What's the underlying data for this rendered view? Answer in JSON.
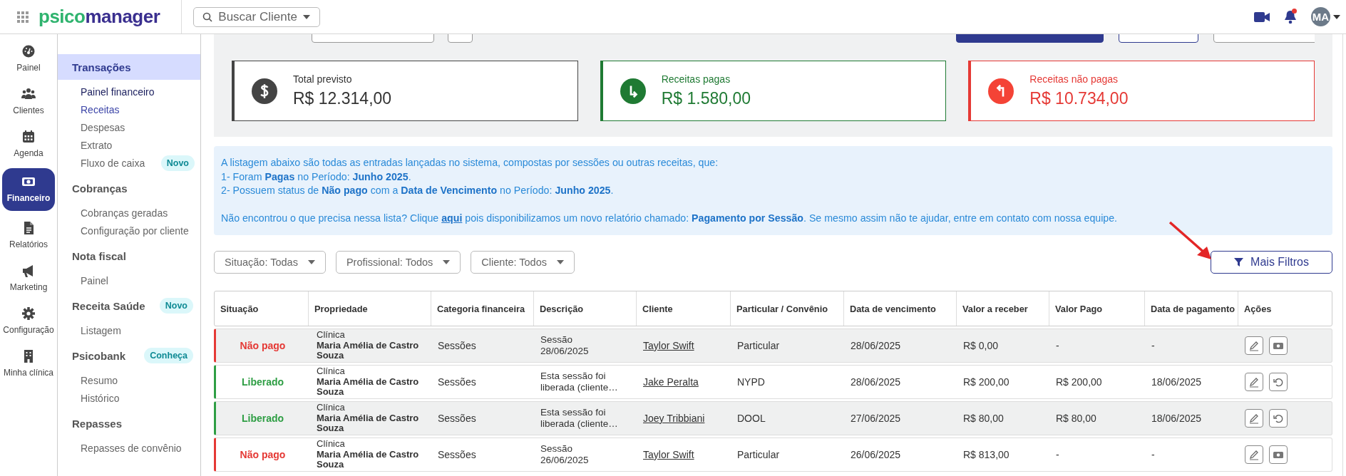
{
  "topbar": {
    "logo": {
      "part_1": "psico",
      "part_2": "manager"
    },
    "search": {
      "label": "Buscar Cliente"
    },
    "notifications": {
      "unread": true
    },
    "avatar": {
      "initials": "MA"
    }
  },
  "rail": [
    {
      "label": "Painel",
      "kind": "dashboard",
      "selected": false
    },
    {
      "label": "Clientes",
      "kind": "people",
      "selected": false
    },
    {
      "label": "Agenda",
      "kind": "calendar",
      "selected": false
    },
    {
      "label": "Financeiro",
      "kind": "money",
      "selected": true
    },
    {
      "label": "Relatórios",
      "kind": "document",
      "selected": false
    },
    {
      "label": "Marketing",
      "kind": "megaphone",
      "selected": false
    },
    {
      "label": "Configuração",
      "kind": "gear",
      "selected": false
    },
    {
      "label": "Minha clínica",
      "kind": "building",
      "selected": false
    }
  ],
  "menu": [
    {
      "title": "Transações",
      "selected": true,
      "items": [
        {
          "label": "Painel financeiro",
          "selected": true,
          "hovered": false
        },
        {
          "label": "Receitas",
          "selected": false,
          "hovered": true
        },
        {
          "label": "Despesas",
          "selected": false,
          "hovered": false
        },
        {
          "label": "Extrato",
          "selected": false,
          "hovered": false
        },
        {
          "label": "Fluxo de caixa",
          "badge": "Novo",
          "selected": false,
          "hovered": false
        }
      ]
    },
    {
      "title": "Cobranças",
      "selected": false,
      "items": [
        {
          "label": "Cobranças geradas",
          "selected": false,
          "hovered": false
        },
        {
          "label": "Configuração por cliente",
          "selected": false,
          "hovered": false
        }
      ]
    },
    {
      "title": "Nota fiscal",
      "selected": false,
      "items": [
        {
          "label": "Painel",
          "selected": false,
          "hovered": false
        }
      ]
    },
    {
      "title": "Receita Saúde",
      "badge": "Novo",
      "selected": false,
      "items": [
        {
          "label": "Listagem",
          "selected": false,
          "hovered": false
        }
      ]
    },
    {
      "title": "Psicobank",
      "badge": "Conheça",
      "selected": false,
      "items": [
        {
          "label": "Resumo",
          "selected": false,
          "hovered": false
        },
        {
          "label": "Histórico",
          "selected": false,
          "hovered": false
        }
      ]
    },
    {
      "title": "Repasses",
      "selected": false,
      "items": [
        {
          "label": "Repasses de convênio",
          "selected": false,
          "hovered": false
        }
      ]
    }
  ],
  "summary": {
    "cards": [
      {
        "kind": "expected",
        "label": "Total previsto",
        "value": "R$ 12.314,00"
      },
      {
        "kind": "paid",
        "label": "Receitas pagas",
        "value": "R$ 1.580,00"
      },
      {
        "kind": "unpaid",
        "label": "Receitas não pagas",
        "value": "R$ 10.734,00"
      }
    ]
  },
  "info": {
    "lines": [
      "A listagem abaixo são todas as entradas lançadas no sistema, compostas por sessões ou outras receitas, que:",
      "1- Foram **Pagas** no Período: **Junho 2025**.",
      "2- Possuem status de **Não pago** com a **Data de Vencimento** no Período: **Junho 2025**."
    ],
    "note": {
      "before": "Não encontrou o que precisa nessa lista? Clique ",
      "link": "aqui",
      "after": " pois disponibilizamos um novo relatório chamado: **Pagamento por Sessão**. Se mesmo assim não te ajudar, entre em contato com nossa equipe."
    }
  },
  "filters": [
    {
      "label": "Situação: Todas"
    },
    {
      "label": "Profissional: Todos"
    },
    {
      "label": "Cliente: Todos"
    }
  ],
  "more_filters": {
    "label": "Mais Filtros"
  },
  "table": {
    "columns": [
      "Situação",
      "Propriedade",
      "Categoria financeira",
      "Descrição",
      "Cliente",
      "Particular / Convênio",
      "Data de vencimento",
      "Valor a receber",
      "Valor Pago",
      "Data de pagamento",
      "Ações"
    ],
    "rows": [
      {
        "status": "Não pago",
        "kind": "unpaid",
        "property_type": "Clínica",
        "property_name": "Maria Amélia de Castro Souza",
        "category": "Sessões",
        "description": "Sessão 28/06/2025",
        "client": "Taylor Swift",
        "plan": "Particular",
        "due_date": "28/06/2025",
        "amount": "R$ 0,00",
        "paid": "-",
        "paid_date": "-",
        "actions": [
          {
            "kind": "edit"
          },
          {
            "kind": "pay"
          }
        ]
      },
      {
        "status": "Liberado",
        "kind": "released",
        "property_type": "Clínica",
        "property_name": "Maria Amélia de Castro Souza",
        "category": "Sessões",
        "description": "Esta sessão foi liberada (cliente…",
        "client": "Jake Peralta",
        "plan": "NYPD",
        "due_date": "28/06/2025",
        "amount": "R$ 200,00",
        "paid": "R$ 200,00",
        "paid_date": "18/06/2025",
        "actions": [
          {
            "kind": "edit"
          },
          {
            "kind": "undo"
          }
        ]
      },
      {
        "status": "Liberado",
        "kind": "released",
        "property_type": "Clínica",
        "property_name": "Maria Amélia de Castro Souza",
        "category": "Sessões",
        "description": "Esta sessão foi liberada (cliente…",
        "client": "Joey Tribbiani",
        "plan": "DOOL",
        "due_date": "27/06/2025",
        "amount": "R$ 80,00",
        "paid": "R$ 80,00",
        "paid_date": "18/06/2025",
        "actions": [
          {
            "kind": "edit"
          },
          {
            "kind": "undo"
          }
        ]
      },
      {
        "status": "Não pago",
        "kind": "unpaid",
        "property_type": "Clínica",
        "property_name": "Maria Amélia de Castro Souza",
        "category": "Sessões",
        "description": "Sessão 26/06/2025",
        "client": "Taylor Swift",
        "plan": "Particular",
        "due_date": "26/06/2025",
        "amount": "R$ 813,00",
        "paid": "-",
        "paid_date": "-",
        "actions": [
          {
            "kind": "edit"
          },
          {
            "kind": "pay"
          }
        ]
      }
    ]
  }
}
